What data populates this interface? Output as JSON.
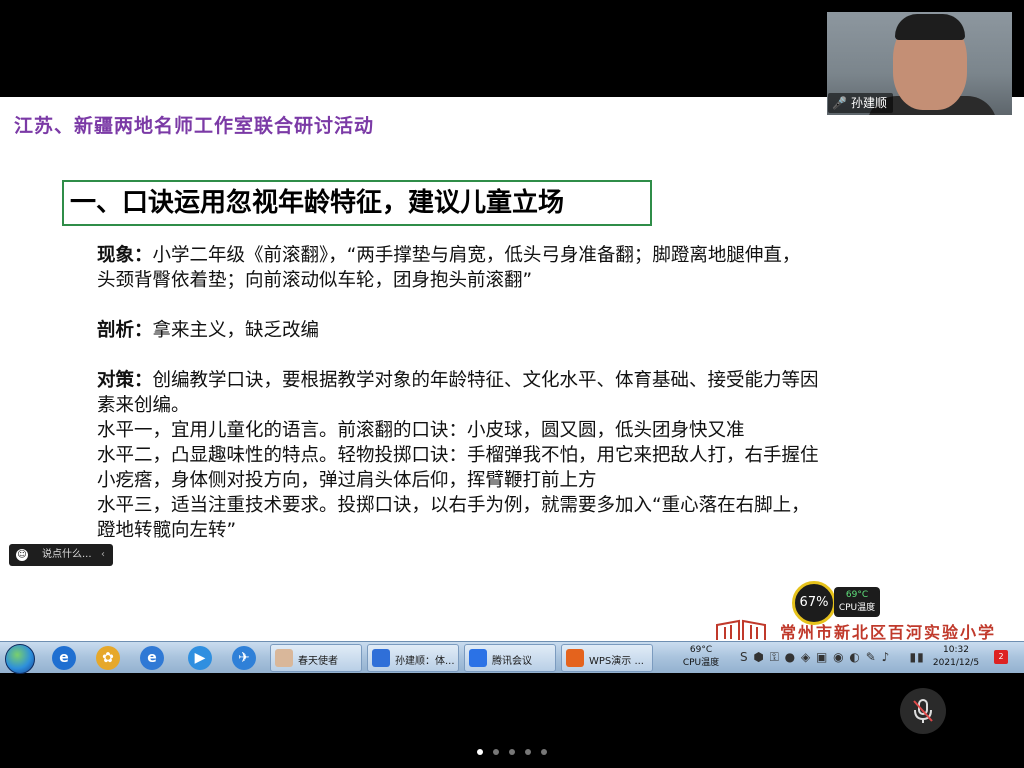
{
  "slide": {
    "header": "江苏、新疆两地名师工作室联合研讨活动",
    "title": "一、口诀运用忽视年龄特征，建议儿童立场",
    "body": {
      "p1_label": "现象：",
      "p1_line1": "小学二年级《前滚翻》，“两手撑垫与肩宽，低头弓身准备翻；脚蹬离地腿伸直，",
      "p1_line2": "头颈背臀依着垫；向前滚动似车轮，团身抱头前滚翻”",
      "p2_label": "剖析：",
      "p2_text": "拿来主义，缺乏改编",
      "p3_label": "对策：",
      "p3_line1": "创编教学口诀，要根据教学对象的年龄特征、文化水平、体育基础、接受能力等因",
      "p3_line2": "素来创编。",
      "l1": "水平一，宜用儿童化的语言。前滚翻的口诀：小皮球，圆又圆，低头团身快又准",
      "l2a": "水平二，凸显趣味性的特点。轻物投掷口诀：手榴弹我不怕，用它来把敌人打，右手握住",
      "l2b": "小疙瘩，身体侧对投方向，弹过肩头体后仰，挥臂鞭打前上方",
      "l3a": "水平三，适当注重技术要求。投掷口诀，以右手为例，就需要多加入“重心落在右脚上，",
      "l3b": "蹬地转髋向左转”"
    },
    "logo_text": "常州市新北区百河实验小学"
  },
  "cpu_widget": {
    "percent": "67%",
    "temp": "69°C",
    "label": "CPU温度"
  },
  "video": {
    "participant_name": "孙建顺"
  },
  "chat": {
    "placeholder": "说点什么..."
  },
  "taskbar": {
    "tasks": [
      "春天使者",
      "孙建顺：体...",
      "腾讯会议",
      "WPS演示 ..."
    ],
    "cpu_temp": "69°C",
    "cpu_label": "CPU温度",
    "time": "10:32",
    "date": "2021/12/5",
    "notification_count": "2"
  },
  "pager": {
    "count": 5,
    "active": 0
  },
  "colors": {
    "header": "#7b3aa6",
    "title_border": "#2f8d48",
    "logo": "#c0392b"
  }
}
